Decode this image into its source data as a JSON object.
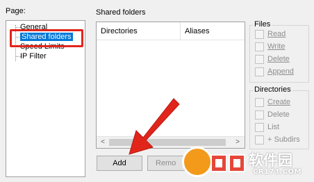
{
  "page": {
    "label": "Page:",
    "items": [
      "General",
      "Shared folders",
      "Speed Limits",
      "IP Filter"
    ],
    "selected": "Shared folders"
  },
  "shared": {
    "title": "Shared folders",
    "columns": [
      "Directories",
      "Aliases"
    ],
    "scroll_left": "<",
    "scroll_right": ">"
  },
  "buttons": {
    "add": "Add",
    "remove": "Remo"
  },
  "files": {
    "title": "Files",
    "options": [
      "Read",
      "Write",
      "Delete",
      "Append"
    ]
  },
  "directories": {
    "title": "Directories",
    "options": [
      "Create",
      "Delete",
      "List",
      "+ Subdirs"
    ]
  },
  "watermark": {
    "text": "软件园",
    "domain": "CR173.COM"
  },
  "colors": {
    "selection": "#0078d7",
    "highlight_box": "#e1251b",
    "arrow": "#e1251b",
    "watermark": "#f39a1b"
  }
}
